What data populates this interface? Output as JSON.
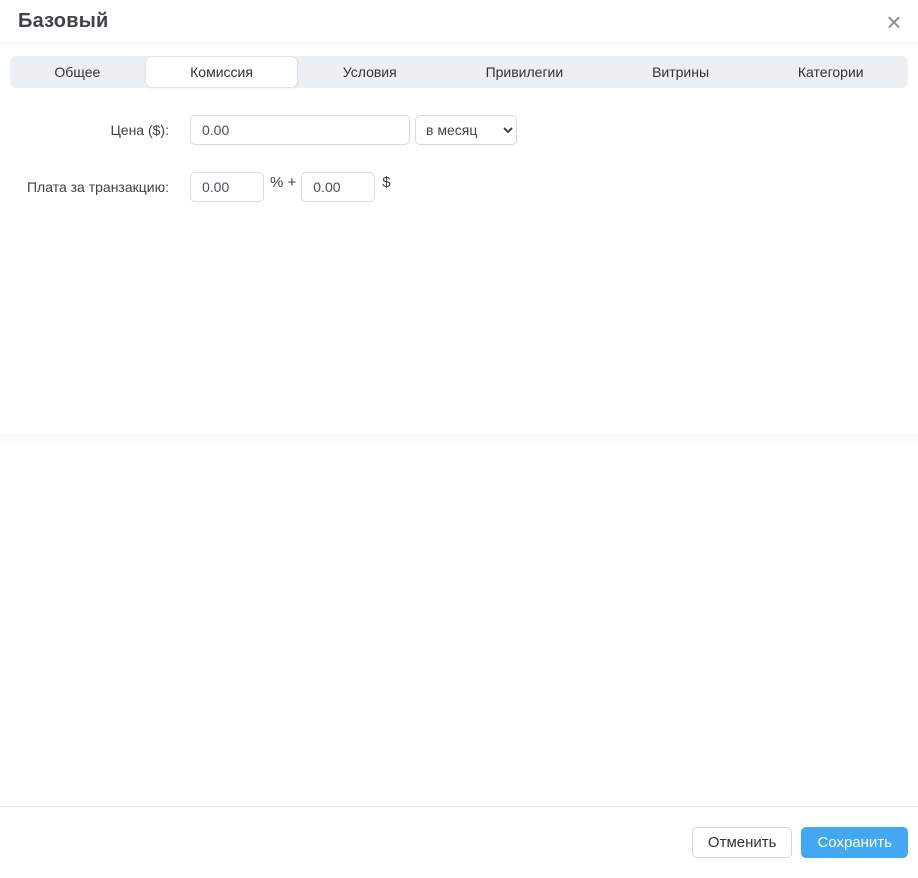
{
  "modal": {
    "title": "Базовый"
  },
  "icons": {
    "close": "×",
    "select_chevron": "⌄"
  },
  "tabs": [
    {
      "label": "Общее"
    },
    {
      "label": "Комиссия"
    },
    {
      "label": "Условия"
    },
    {
      "label": "Привилегии"
    },
    {
      "label": "Витрины"
    },
    {
      "label": "Категории"
    }
  ],
  "active_tab": "Комиссия",
  "form": {
    "price": {
      "label": "Цена ($):",
      "value": "0.00",
      "period_selected": "в месяц"
    },
    "transaction_fee": {
      "label": "Плата за транзакцию:",
      "percent_value": "0.00",
      "percent_suffix": "% +",
      "fixed_value": "0.00",
      "fixed_suffix": "$"
    }
  },
  "footer": {
    "cancel_label": "Отменить",
    "save_label": "Сохранить"
  },
  "colors": {
    "accent": "#42a8f2",
    "tabbar_bg": "#edf0f2",
    "input_border": "#d5dce4",
    "title_text": "#3e4347"
  }
}
